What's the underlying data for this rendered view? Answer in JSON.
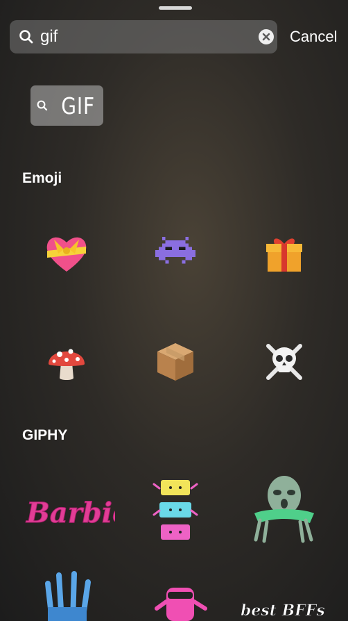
{
  "search": {
    "value": "gif"
  },
  "cancel_label": "Cancel",
  "suggestion_chip": {
    "label": "GIF"
  },
  "sections": {
    "emoji": {
      "title": "Emoji",
      "items": [
        "heart-with-ribbon",
        "space-invader",
        "wrapped-gift",
        "mushroom",
        "package",
        "skull-and-crossbones"
      ]
    },
    "giphy": {
      "title": "GIPHY",
      "items": [
        {
          "name": "barbie-sticker",
          "text": "Barbie"
        },
        {
          "name": "stacked-blocks-sticker"
        },
        {
          "name": "alien-sticker"
        },
        {
          "name": "hand-sticker"
        },
        {
          "name": "pink-character-sticker"
        },
        {
          "name": "best-bffs-sticker",
          "text": "best BFFs"
        }
      ]
    }
  },
  "colors": {
    "background": "#2e2b27",
    "search_bg": "#767676",
    "text": "#ffffff"
  }
}
